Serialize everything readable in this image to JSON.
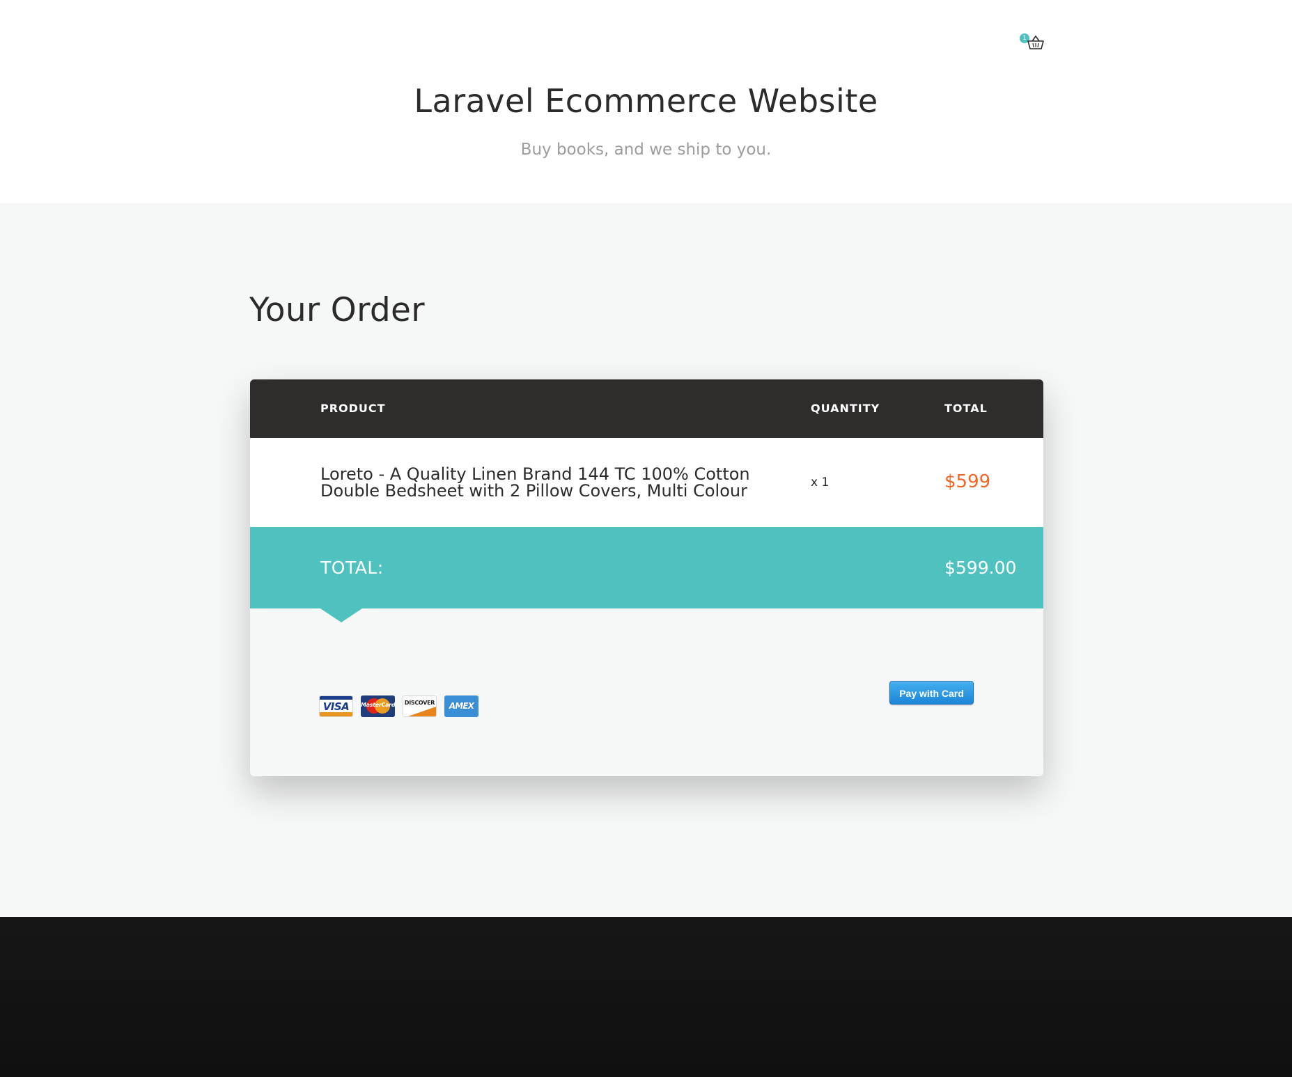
{
  "header": {
    "cart_count": "1",
    "title": "Laravel Ecommerce Website",
    "subtitle": "Buy books, and we ship to you."
  },
  "main": {
    "page_title": "Your Order",
    "table": {
      "columns": [
        "PRODUCT",
        "QUANTITY",
        "TOTAL"
      ],
      "rows": [
        {
          "product": "Loreto - A Quality Linen Brand 144 TC 100% Cotton Double Bedsheet with 2 Pillow Covers, Multi Colour",
          "quantity": "x 1",
          "total": "$599"
        }
      ]
    },
    "summary": {
      "total_label": "TOTAL:",
      "total_amount": "$599.00"
    },
    "payment": {
      "card_logos": [
        {
          "name": "visa",
          "text": "VISA"
        },
        {
          "name": "mastercard",
          "text": "MasterCard"
        },
        {
          "name": "discover",
          "text": "DISCOVER"
        },
        {
          "name": "amex",
          "text": "AMEX"
        }
      ],
      "pay_button_label": "Pay with Card"
    }
  },
  "colors": {
    "accent": "#4fc1bf",
    "price": "#f26522",
    "table_header": "#2e2d2c",
    "footer": "#141414"
  }
}
